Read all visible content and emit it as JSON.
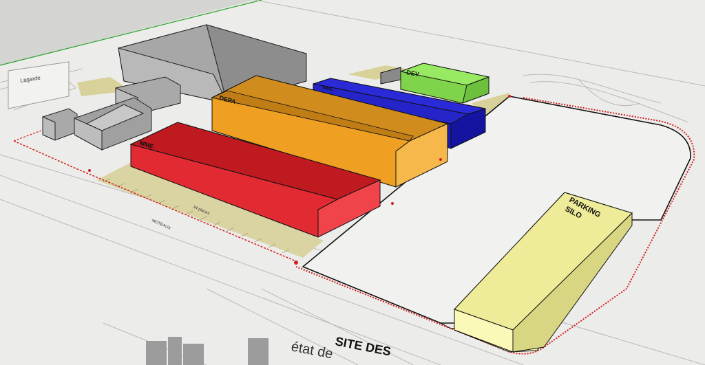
{
  "buildings": {
    "red": {
      "label": "MME",
      "color": "#e8232b"
    },
    "orange": {
      "label": "DEPA",
      "color": "#f3a72a"
    },
    "blue": {
      "label": "MDE",
      "color": "#1f1fd0"
    },
    "green": {
      "label": "DEV",
      "color": "#8ee35a"
    },
    "parking": {
      "label_line1": "PARKING",
      "label_line2": "SILO",
      "color": "#f4f2a2"
    }
  },
  "site_title": "SITE DES",
  "site_subtitle": "état de",
  "sign_label": "Lagarde",
  "street_labels": [
    "MOTEAUX"
  ],
  "places_label": "34 places"
}
